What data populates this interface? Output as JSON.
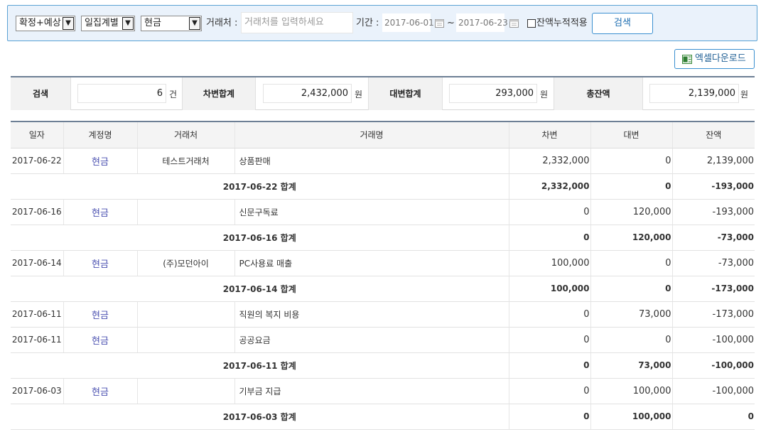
{
  "search": {
    "status_select": "확정+예상",
    "group_select": "일집계별",
    "account_select": "현금",
    "vendor_label": "거래처 :",
    "vendor_placeholder": "거래처를 입력하세요",
    "period_label": "기간 :",
    "date_from": "2017-06-01",
    "date_sep": "~",
    "date_to": "2017-06-23",
    "cumulative_label": "잔액누적적용",
    "search_button": "검색"
  },
  "toolbar": {
    "excel_button": "엑셀다운로드"
  },
  "summary": {
    "count_label": "검색",
    "count_value": "6",
    "count_unit": "건",
    "debit_label": "차변합계",
    "debit_value": "2,432,000",
    "debit_unit": "원",
    "credit_label": "대변합계",
    "credit_value": "293,000",
    "credit_unit": "원",
    "balance_label": "총잔액",
    "balance_value": "2,139,000",
    "balance_unit": "원"
  },
  "table": {
    "headers": [
      "일자",
      "계정명",
      "거래처",
      "거래명",
      "차변",
      "대변",
      "잔액"
    ],
    "rows": [
      {
        "type": "entry",
        "date": "2017-06-22",
        "account": "현금",
        "vendor": "테스트거래처",
        "desc": "상품판매",
        "debit": "2,332,000",
        "credit": "0",
        "balance": "2,139,000"
      },
      {
        "type": "subtotal",
        "label": "2017-06-22 합계",
        "debit": "2,332,000",
        "credit": "0",
        "balance": "-193,000"
      },
      {
        "type": "entry",
        "date": "2017-06-16",
        "account": "현금",
        "vendor": "",
        "desc": "신문구독료",
        "debit": "0",
        "credit": "120,000",
        "balance": "-193,000"
      },
      {
        "type": "subtotal",
        "label": "2017-06-16 합계",
        "debit": "0",
        "credit": "120,000",
        "balance": "-73,000"
      },
      {
        "type": "entry",
        "date": "2017-06-14",
        "account": "현금",
        "vendor": "(주)모던아이",
        "desc": "PC사용료 매출",
        "debit": "100,000",
        "credit": "0",
        "balance": "-73,000"
      },
      {
        "type": "subtotal",
        "label": "2017-06-14 합계",
        "debit": "100,000",
        "credit": "0",
        "balance": "-173,000"
      },
      {
        "type": "entry",
        "date": "2017-06-11",
        "account": "현금",
        "vendor": "",
        "desc": "직원의 복지 비용",
        "debit": "0",
        "credit": "73,000",
        "balance": "-173,000"
      },
      {
        "type": "entry",
        "date": "2017-06-11",
        "account": "현금",
        "vendor": "",
        "desc": "공공요금",
        "debit": "0",
        "credit": "0",
        "balance": "-100,000"
      },
      {
        "type": "subtotal",
        "label": "2017-06-11 합계",
        "debit": "0",
        "credit": "73,000",
        "balance": "-100,000"
      },
      {
        "type": "entry",
        "date": "2017-06-03",
        "account": "현금",
        "vendor": "",
        "desc": "기부금 지급",
        "debit": "0",
        "credit": "100,000",
        "balance": "-100,000"
      },
      {
        "type": "subtotal",
        "label": "2017-06-03 합계",
        "debit": "0",
        "credit": "100,000",
        "balance": "0"
      }
    ]
  }
}
